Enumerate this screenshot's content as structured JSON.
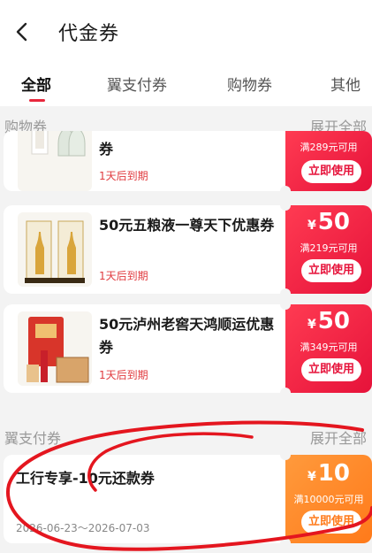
{
  "header": {
    "title": "代金券",
    "back_icon": "chevron-left-icon"
  },
  "tabs": [
    {
      "label": "全部",
      "active": true
    },
    {
      "label": "翼支付券",
      "active": false
    },
    {
      "label": "购物券",
      "active": false
    },
    {
      "label": "其他",
      "active": false
    }
  ],
  "sections": {
    "shopping": {
      "title": "购物券",
      "expand": "展开全部"
    },
    "yizhifu": {
      "title": "翼支付券",
      "expand": "展开全部"
    }
  },
  "coupons": [
    {
      "name_line2": "券",
      "expiry": "1天后到期",
      "condition": "满289元可用",
      "button": "立即使用"
    },
    {
      "name": "50元五粮液一尊天下优惠券",
      "expiry": "1天后到期",
      "symbol": "¥",
      "amount": "50",
      "condition": "满219元可用",
      "button": "立即使用"
    },
    {
      "name": "50元泸州老窖天鸿顺运优惠券",
      "expiry": "1天后到期",
      "symbol": "¥",
      "amount": "50",
      "condition": "满349元可用",
      "button": "立即使用"
    },
    {
      "name": "工行专享-10元还款券",
      "validity": "2026-06-23～2026-07-03",
      "symbol": "¥",
      "amount": "10",
      "condition": "满10000元可用",
      "button": "立即使用"
    }
  ],
  "colors": {
    "accent_red": "#e6123a",
    "accent_orange": "#ff7a1a",
    "expiry_red": "#e03a3e"
  }
}
